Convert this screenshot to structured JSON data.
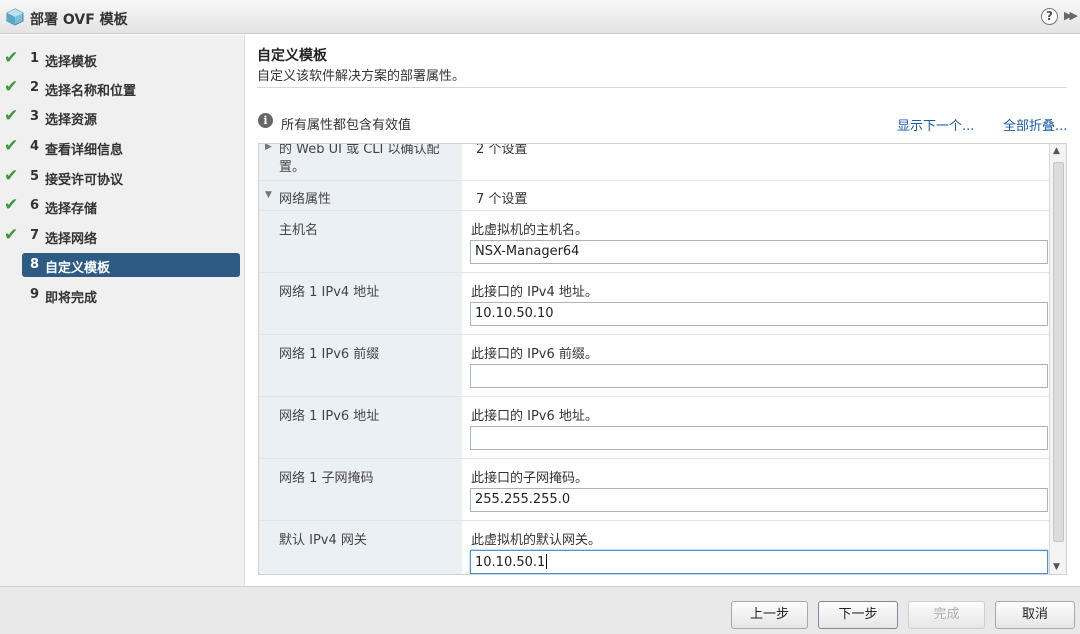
{
  "window": {
    "title": "部署 OVF 模板",
    "help_glyph": "?",
    "expand_glyph": "▶▶"
  },
  "nav": {
    "steps": [
      {
        "num": "1",
        "label": "选择模板",
        "done": true
      },
      {
        "num": "2",
        "label": "选择名称和位置",
        "done": true
      },
      {
        "num": "3",
        "label": "选择资源",
        "done": true
      },
      {
        "num": "4",
        "label": "查看详细信息",
        "done": true
      },
      {
        "num": "5",
        "label": "接受许可协议",
        "done": true
      },
      {
        "num": "6",
        "label": "选择存储",
        "done": true
      },
      {
        "num": "7",
        "label": "选择网络",
        "done": true
      },
      {
        "num": "8",
        "label": "自定义模板",
        "active": true
      },
      {
        "num": "9",
        "label": "即将完成"
      }
    ],
    "check_glyph": "✔"
  },
  "main": {
    "title": "自定义模板",
    "subtitle": "自定义该软件解决方案的部署属性。",
    "info_text": "所有属性都包含有效值",
    "show_next_link": "显示下一个...",
    "collapse_all_link": "全部折叠..."
  },
  "grid": {
    "partial_row": {
      "label_line1": "的 Web UI 或 CLI 以确认配",
      "label_line2": "置。",
      "count": "2 个设置"
    },
    "group": {
      "label": "网络属性",
      "count": "7 个设置",
      "expanded": true
    },
    "rows": [
      {
        "label": "主机名",
        "desc": "此虚拟机的主机名。",
        "value": "NSX-Manager64"
      },
      {
        "label": "网络 1 IPv4 地址",
        "desc": "此接口的 IPv4 地址。",
        "value": "10.10.50.10"
      },
      {
        "label": "网络 1 IPv6 前缀",
        "desc": "此接口的 IPv6 前缀。",
        "value": ""
      },
      {
        "label": "网络 1 IPv6 地址",
        "desc": "此接口的 IPv6 地址。",
        "value": ""
      },
      {
        "label": "网络 1 子网掩码",
        "desc": "此接口的子网掩码。",
        "value": "255.255.255.0"
      },
      {
        "label": "默认 IPv4 网关",
        "desc": "此虚拟机的默认网关。",
        "value": "10.10.50.1",
        "focused": true
      }
    ]
  },
  "footer": {
    "back": "上一步",
    "next": "下一步",
    "finish": "完成",
    "cancel": "取消"
  },
  "colors": {
    "active_step": "#2e5b84",
    "check": "#3a9a3a",
    "link": "#1a5aa8",
    "label_column": "#ebf0f5"
  }
}
